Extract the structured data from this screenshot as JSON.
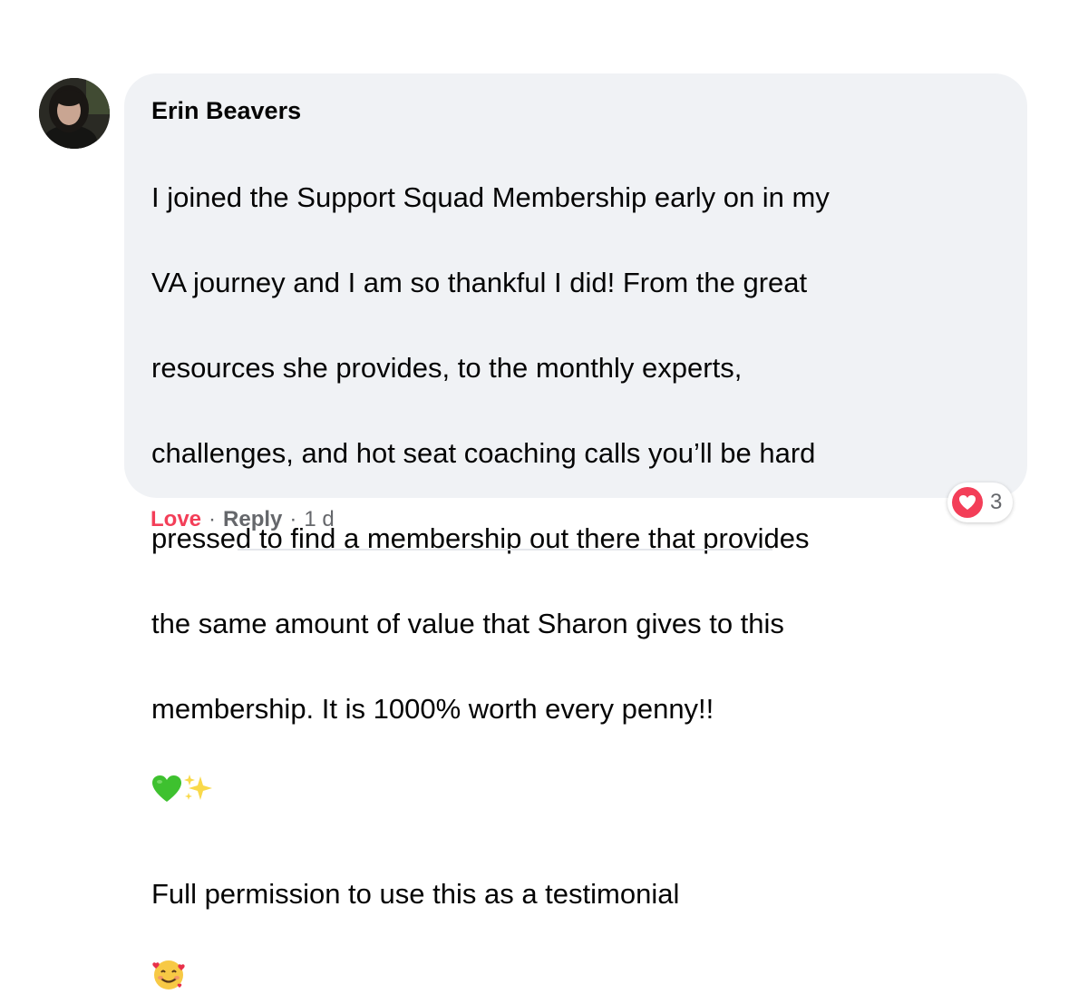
{
  "comment": {
    "author": "Erin Beavers",
    "body_lines": [
      "I joined the Support Squad Membership early on in my",
      "VA journey and I am so thankful I did! From the great",
      "resources she provides, to the monthly experts,",
      "challenges, and hot seat coaching calls you’ll be hard",
      "pressed to find a membership out there that provides",
      "the same amount of value that Sharon gives to this",
      "membership. It is 1000% worth every penny!!"
    ],
    "body_emojis": [
      "green-heart-icon",
      "sparkles-icon"
    ],
    "second_paragraph": "Full permission to use this as a testimonial",
    "second_emoji": "smiling-face-with-hearts-icon"
  },
  "reactions": {
    "icon": "love-reaction-icon",
    "count": "3"
  },
  "actions": {
    "love": "Love",
    "separator": "·",
    "reply": "Reply",
    "time": "1 d"
  },
  "colors": {
    "bubble_bg": "#f0f2f5",
    "love_red": "#f33e58",
    "muted_text": "#65676b",
    "green_heart": "#3ec12f",
    "sparkle_yellow": "#f9d94a"
  }
}
